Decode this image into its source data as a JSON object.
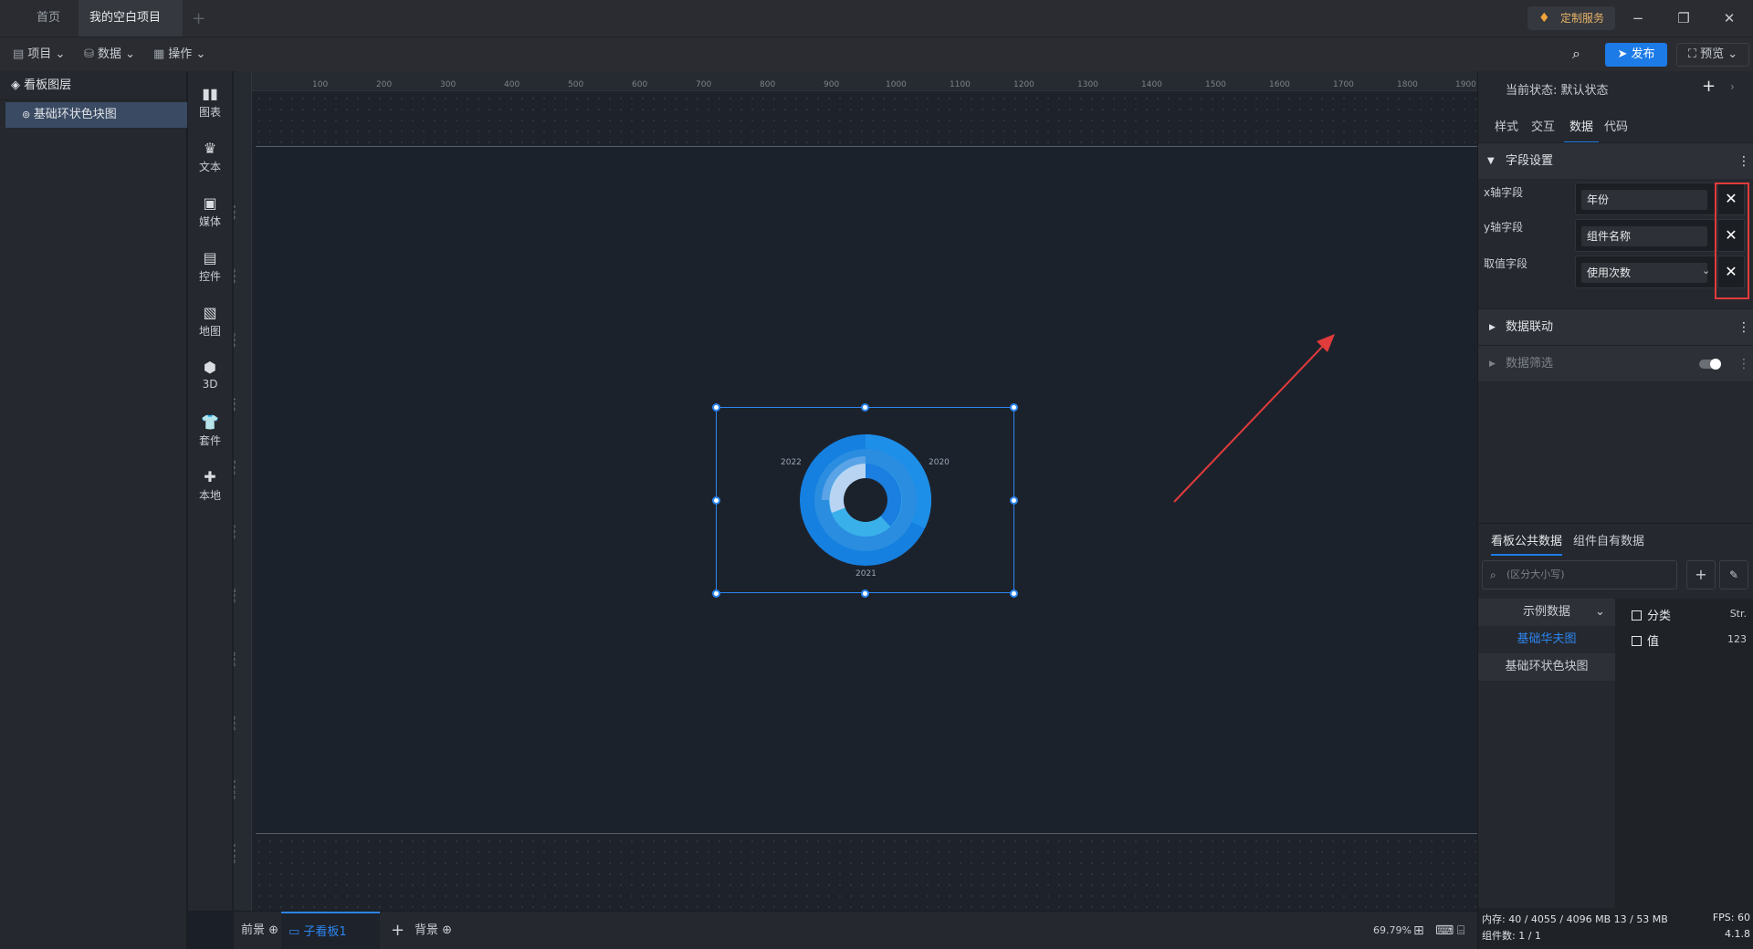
{
  "tabs": {
    "home": "首页",
    "project": "我的空白项目"
  },
  "window": {
    "custom_service": "定制服务",
    "minimize": "−",
    "maximize": "❐",
    "close": "✕"
  },
  "toolbar": {
    "project": "项目",
    "data": "数据",
    "ops": "操作",
    "publish": "发布",
    "preview": "预览"
  },
  "layers": {
    "title": "看板图层",
    "item": "基础环状色块图"
  },
  "components": [
    "图表",
    "文本",
    "媒体",
    "控件",
    "地图",
    "3D",
    "套件",
    "本地"
  ],
  "ruler": {
    "top": [
      "100",
      "200",
      "300",
      "400",
      "500",
      "600",
      "700",
      "800",
      "900",
      "1000",
      "1100",
      "1200",
      "1300",
      "1400",
      "1500",
      "1600",
      "1700",
      "1800",
      "1900"
    ],
    "left": [
      "100",
      "200",
      "300",
      "400",
      "500",
      "600",
      "700",
      "800",
      "900",
      "1000",
      "1100"
    ]
  },
  "chart": {
    "labels": [
      "2022",
      "2020",
      "2021"
    ]
  },
  "bottom": {
    "front": "前景",
    "sub": "子看板1",
    "back": "背景",
    "zoom": "69.79%"
  },
  "right": {
    "state_label": "当前状态:",
    "state_value": "默认状态",
    "tabs": [
      "样式",
      "交互",
      "数据",
      "代码"
    ],
    "field_section": "字段设置",
    "fields": [
      {
        "label": "x轴字段",
        "value": "年份"
      },
      {
        "label": "y轴字段",
        "value": "组件名称"
      },
      {
        "label": "取值字段",
        "value": "使用次数"
      }
    ],
    "linkage": "数据联动",
    "filter": "数据筛选",
    "data_tabs": [
      "看板公共数据",
      "组件自有数据"
    ],
    "search_placeholder": "(区分大小写)",
    "dataset_group": "示例数据",
    "datasets": [
      "基础华夫图",
      "基础环状色块图"
    ],
    "columns": [
      {
        "name": "分类",
        "type": "Str."
      },
      {
        "name": "值",
        "type": "123"
      }
    ],
    "status": {
      "memory": "内存: 40 / 4055 / 4096 MB 13 / 53 MB",
      "fps": "FPS: 60",
      "count": "组件数: 1 / 1",
      "version": "4.1.8"
    }
  },
  "colors": {
    "accent": "#1d7be8",
    "highlight": "#e23b3b"
  }
}
